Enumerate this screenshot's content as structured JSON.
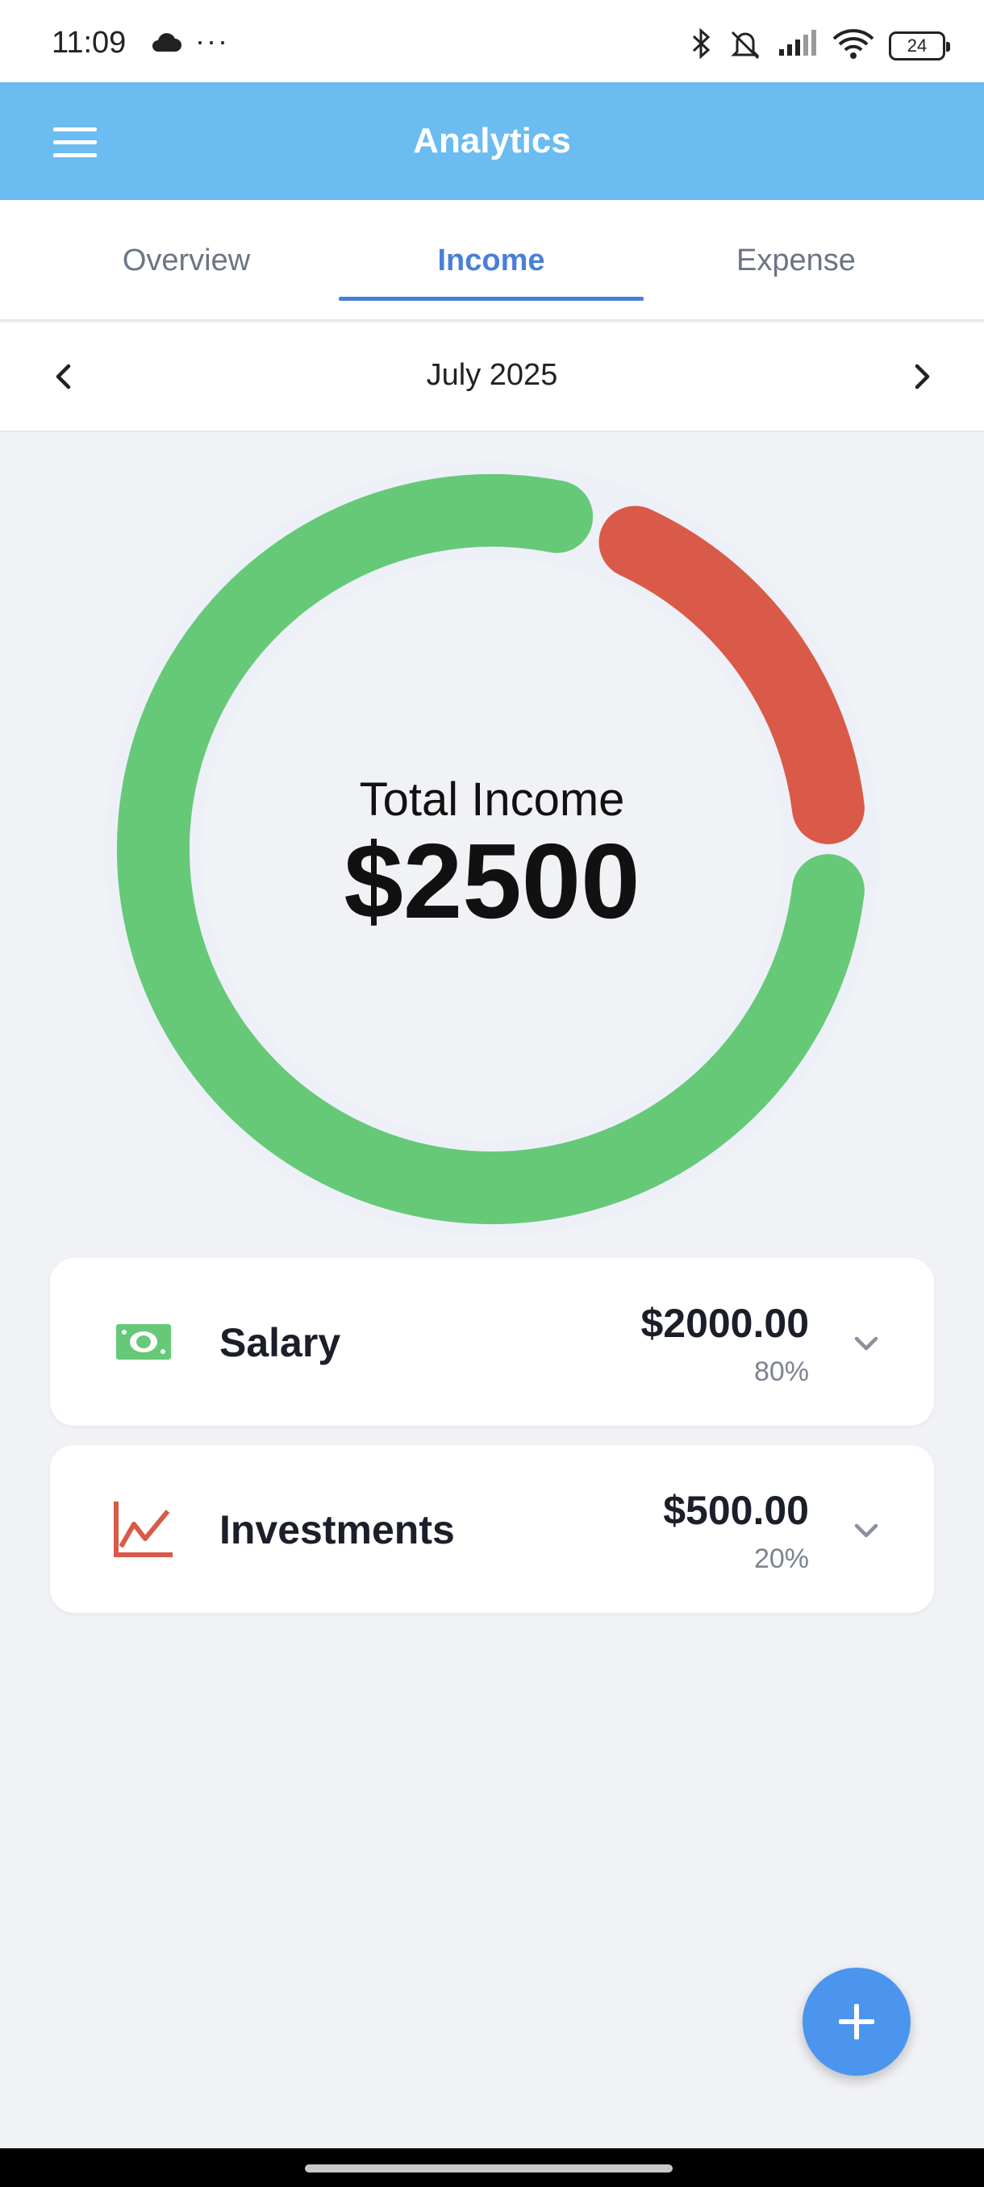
{
  "status_bar": {
    "time": "11:09",
    "more": "···",
    "battery": "24",
    "icons": [
      "cloud-icon",
      "bluetooth-icon",
      "bell-muted-icon",
      "signal-icon",
      "wifi-icon",
      "battery-icon"
    ]
  },
  "app_bar": {
    "title": "Analytics",
    "menu_icon": "hamburger-menu-icon",
    "color": "#6bbcf0"
  },
  "tabs": [
    {
      "label": "Overview",
      "active": false
    },
    {
      "label": "Income",
      "active": true
    },
    {
      "label": "Expense",
      "active": false
    }
  ],
  "month_nav": {
    "label": "July 2025",
    "prev_icon": "chevron-left-icon",
    "next_icon": "chevron-right-icon"
  },
  "summary": {
    "label": "Total Income",
    "value": "$2500"
  },
  "chart_data": {
    "type": "pie",
    "title": "",
    "categories": [
      "Salary",
      "Investments"
    ],
    "values": [
      2000,
      500
    ],
    "colors": [
      "#66c978",
      "#d95a48"
    ],
    "center_text": [
      "Total Income",
      "$2500"
    ]
  },
  "categories": [
    {
      "name": "Salary",
      "amount": "$2000.00",
      "percent": "80%",
      "icon": "cash-bill-icon",
      "color": "#66c978"
    },
    {
      "name": "Investments",
      "amount": "$500.00",
      "percent": "20%",
      "icon": "trending-chart-icon",
      "color": "#d95a48"
    }
  ],
  "fab": {
    "icon": "plus-icon",
    "color": "#4b95ee"
  }
}
